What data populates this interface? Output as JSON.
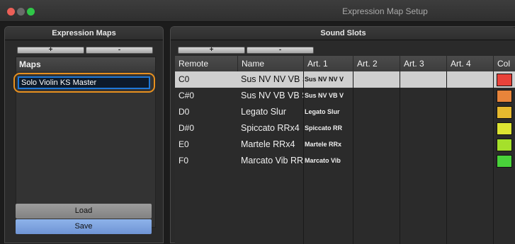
{
  "window": {
    "title": "Expression Map Setup"
  },
  "left_panel": {
    "title": "Expression Maps",
    "add_label": "+",
    "remove_label": "-",
    "maps_header": "Maps",
    "maps": [
      "Solo Violin KS Master"
    ],
    "load_label": "Load",
    "save_label": "Save"
  },
  "right_panel": {
    "title": "Sound Slots",
    "add_label": "+",
    "remove_label": "-",
    "columns": [
      "Remote",
      "Name",
      "Art. 1",
      "Art. 2",
      "Art. 3",
      "Art. 4",
      "Col"
    ],
    "rows": [
      {
        "remote": "C0",
        "name": "Sus NV NV VB S",
        "art1": "Sus NV NV V",
        "color": "#e8423a"
      },
      {
        "remote": "C#0",
        "name": "Sus NV VB VB S",
        "art1": "Sus NV VB V",
        "color": "#e8843a"
      },
      {
        "remote": "D0",
        "name": "Legato Slur",
        "art1": "Legato Slur",
        "color": "#e6b92e"
      },
      {
        "remote": "D#0",
        "name": "Spiccato RRx4",
        "art1": "Spiccato RR",
        "color": "#dde432"
      },
      {
        "remote": "E0",
        "name": "Martele RRx4",
        "art1": "Martele RRx",
        "color": "#a5e02b"
      },
      {
        "remote": "F0",
        "name": "Marcato Vib RR",
        "art1": "Marcato Vib",
        "color": "#49d23a"
      }
    ]
  },
  "colors": {
    "selection_outline": "#e8901e",
    "save_button": "#7fa4e0"
  }
}
